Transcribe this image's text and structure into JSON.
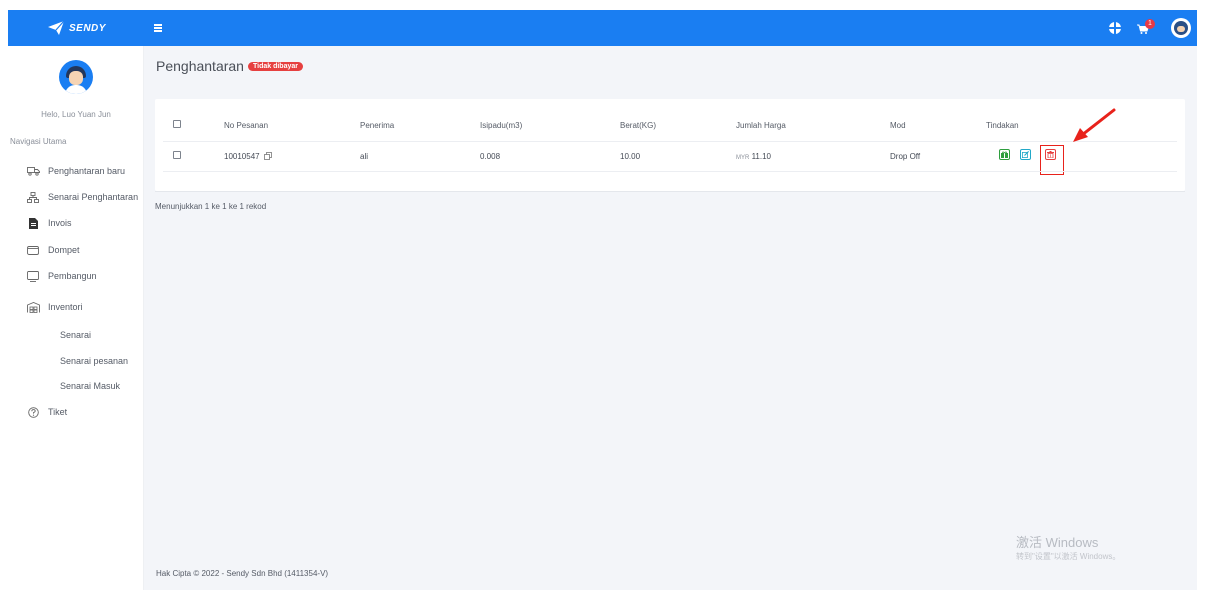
{
  "header": {
    "logo_text": "SENDY",
    "cart_count": "1"
  },
  "sidebar": {
    "greeting": "Helo, Luo Yuan Jun",
    "nav_heading": "Navigasi Utama",
    "items": [
      {
        "label": "Penghantaran baru",
        "icon": "truck-icon"
      },
      {
        "label": "Senarai Penghantaran",
        "icon": "network-icon"
      },
      {
        "label": "Invois",
        "icon": "file-icon"
      },
      {
        "label": "Dompet",
        "icon": "wallet-icon"
      },
      {
        "label": "Pembangun",
        "icon": "monitor-icon"
      },
      {
        "label": "Inventori",
        "icon": "warehouse-icon"
      }
    ],
    "subitems": [
      {
        "label": "Senarai"
      },
      {
        "label": "Senarai pesanan"
      },
      {
        "label": "Senarai Masuk"
      }
    ],
    "ticket": {
      "label": "Tiket",
      "icon": "help-circle-icon"
    }
  },
  "main": {
    "page_title": "Penghantaran",
    "status_badge": "Tidak dibayar",
    "table": {
      "headers": [
        "No Pesanan",
        "Penerima",
        "Isipadu(m3)",
        "Berat(KG)",
        "Jumlah Harga",
        "Mod",
        "Tindakan"
      ],
      "rows": [
        {
          "order_no": "10010547",
          "recipient": "ali",
          "volume": "0.008",
          "weight": "10.00",
          "currency": "MYR",
          "price": "11.10",
          "mode": "Drop Off"
        }
      ]
    },
    "showing_text": "Menunjukkan 1 ke 1 ke 1 rekod"
  },
  "footer": {
    "copyright": "Hak Cipta © 2022 - Sendy Sdn Bhd (1411354-V)"
  },
  "watermark": {
    "title": "激活 Windows",
    "subtitle": "转到\"设置\"以激活 Windows。"
  },
  "colors": {
    "primary": "#1a7ef2",
    "danger": "#e64040",
    "success": "#2e9e3e",
    "info": "#22a8c8",
    "annotation": "#e8221b"
  }
}
